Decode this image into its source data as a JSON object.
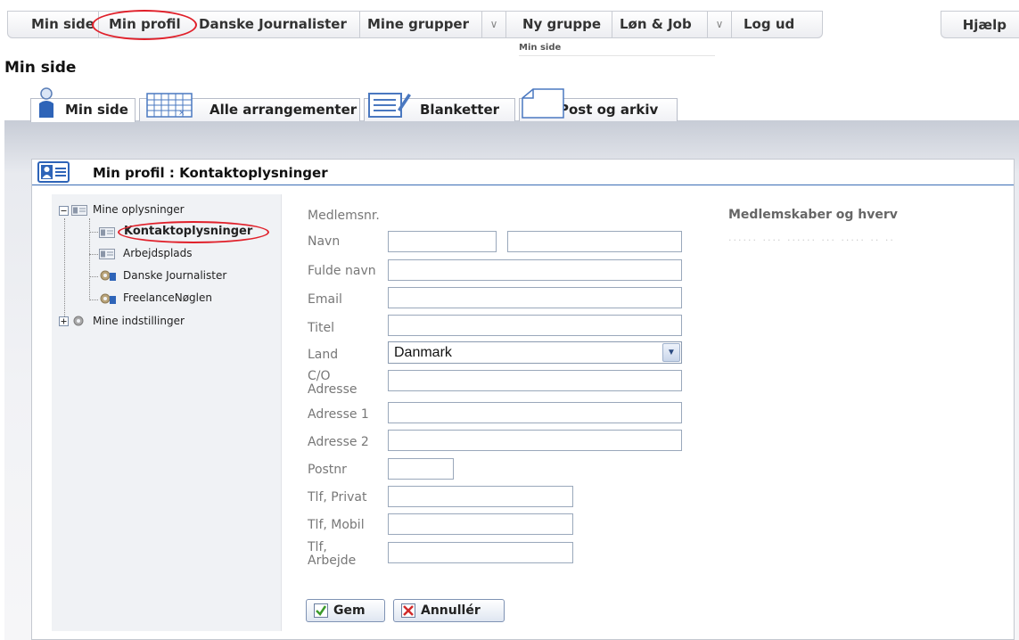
{
  "topnav": {
    "items": [
      "Min side",
      "Min profil",
      "Danske Journalister",
      "Mine grupper",
      "Ny gruppe",
      "Løn & Job",
      "Log ud"
    ],
    "help": "Hjælp",
    "breadcrumb": "Min side"
  },
  "page_title": "Min side",
  "tabs": [
    "Min side",
    "Alle arrangementer",
    "Blanketter",
    "Post og arkiv"
  ],
  "panel_title": "Min profil : Kontaktoplysninger",
  "tree": {
    "root1": "Mine oplysninger",
    "children": [
      "Kontaktoplysninger",
      "Arbejdsplads",
      "Danske Journalister",
      "FreelanceNøglen"
    ],
    "root2": "Mine indstillinger"
  },
  "form": {
    "labels": [
      "Medlemsnr.",
      "Navn",
      "Fulde navn",
      "Email",
      "Titel",
      "Land",
      "C/O Adresse",
      "Adresse 1",
      "Adresse 2",
      "Postnr",
      "Tlf, Privat",
      "Tlf, Mobil",
      "Tlf, Arbejde"
    ],
    "country_value": "Danmark"
  },
  "right_heading": "Medlemskaber og hverv",
  "buttons": {
    "save": "Gem",
    "cancel": "Annullér"
  },
  "colors": {
    "accent_blue": "#2e64b8",
    "highlight_red": "#e0202a",
    "tree_bg": "#f0f2f5"
  }
}
